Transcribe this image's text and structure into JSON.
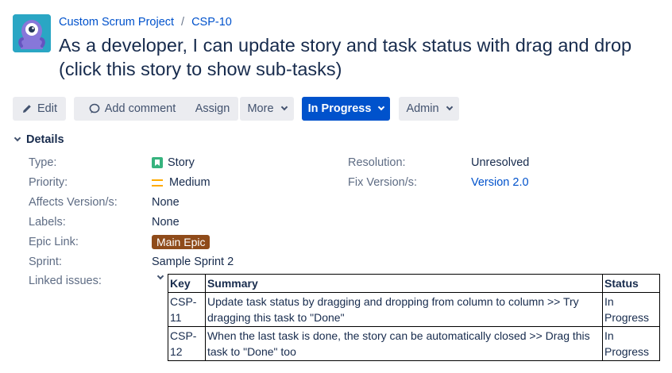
{
  "breadcrumb": {
    "project": "Custom Scrum Project",
    "separator": "/",
    "issue_key": "CSP-10"
  },
  "issue": {
    "title": "As a developer, I can update story and task status with drag and drop (click this story to show sub-tasks)"
  },
  "toolbar": {
    "edit": "Edit",
    "add_comment": "Add comment",
    "assign": "Assign",
    "more": "More",
    "status": "In Progress",
    "admin": "Admin"
  },
  "details": {
    "heading": "Details",
    "type_label": "Type:",
    "type_value": "Story",
    "priority_label": "Priority:",
    "priority_value": "Medium",
    "affects_label": "Affects Version/s:",
    "affects_value": "None",
    "labels_label": "Labels:",
    "labels_value": "None",
    "epic_label": "Epic Link:",
    "epic_value": "Main Epic",
    "sprint_label": "Sprint:",
    "sprint_value": "Sample Sprint 2",
    "linked_label": "Linked issues:",
    "resolution_label": "Resolution:",
    "resolution_value": "Unresolved",
    "fix_label": "Fix Version/s:",
    "fix_value": "Version 2.0"
  },
  "linked_issues": {
    "headers": [
      "Key",
      "Summary",
      "Status"
    ],
    "rows": [
      {
        "key": "CSP-11",
        "summary": "Update task status by dragging and dropping from column to column >> Try dragging this task to \"Done\"",
        "status": "In Progress"
      },
      {
        "key": "CSP-12",
        "summary": "When the last task is done, the story can be automatically closed >> Drag this task to \"Done\" too",
        "status": "In Progress"
      }
    ]
  },
  "icons": {
    "avatar": "project-avatar-icon",
    "edit": "pencil-icon",
    "comment": "comment-icon",
    "type": "story-icon",
    "priority": "priority-medium-icon"
  },
  "colors": {
    "primary": "#0052cc",
    "text": "#172b4d",
    "muted": "#5e6c84",
    "button_bg": "#ebecf0",
    "story": "#36b37e",
    "priority_medium": "#ffab00",
    "epic": "#8f4b1a",
    "avatar_bg": "#2aa6c4"
  }
}
